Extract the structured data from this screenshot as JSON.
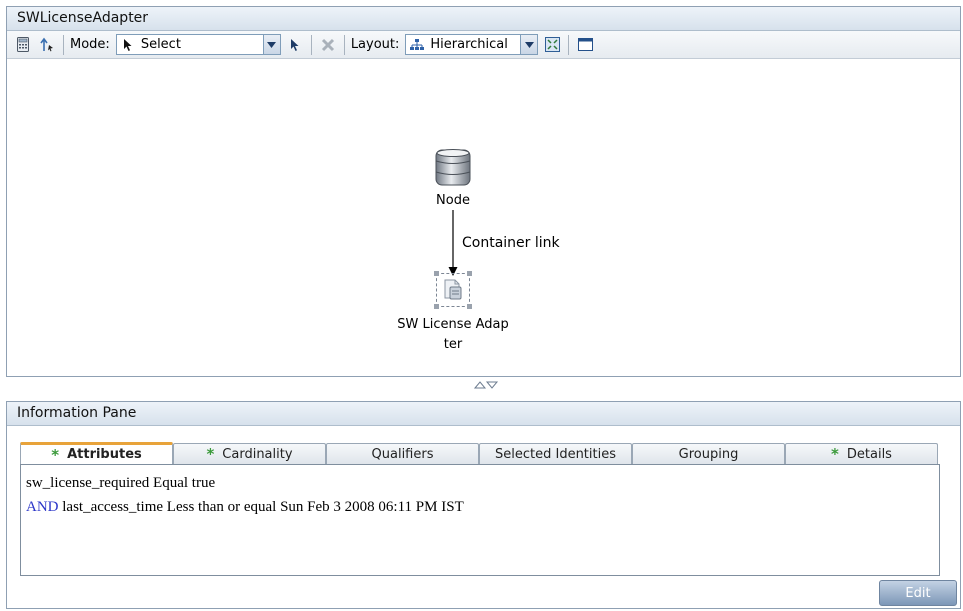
{
  "window": {
    "title": "SWLicenseAdapter"
  },
  "toolbar": {
    "mode_label": "Mode:",
    "mode_value": "Select",
    "layout_label": "Layout:",
    "layout_value": "Hierarchical"
  },
  "graph": {
    "node_top": {
      "label": "Node"
    },
    "edge": {
      "label": "Container link"
    },
    "node_bottom": {
      "label_line1": "SW License Adap",
      "label_line2": "ter"
    }
  },
  "info_pane": {
    "title": "Information Pane",
    "tabs": [
      {
        "label": "Attributes",
        "starred": true,
        "active": true
      },
      {
        "label": "Cardinality",
        "starred": true,
        "active": false
      },
      {
        "label": "Qualifiers",
        "starred": false,
        "active": false
      },
      {
        "label": "Selected Identities",
        "starred": false,
        "active": false
      },
      {
        "label": "Grouping",
        "starred": false,
        "active": false
      },
      {
        "label": "Details",
        "starred": true,
        "active": false
      }
    ],
    "star_glyph": "*",
    "conditions": {
      "line1": "sw_license_required Equal true",
      "line2_keyword": "AND",
      "line2_rest": "last_access_time Less than or equal Sun Feb 3 2008 06:11 PM IST"
    },
    "edit_label": "Edit"
  },
  "colors": {
    "keyword": "#2b35c8",
    "star": "#3a9a3a",
    "active_tab_accent": "#e8a33a"
  }
}
